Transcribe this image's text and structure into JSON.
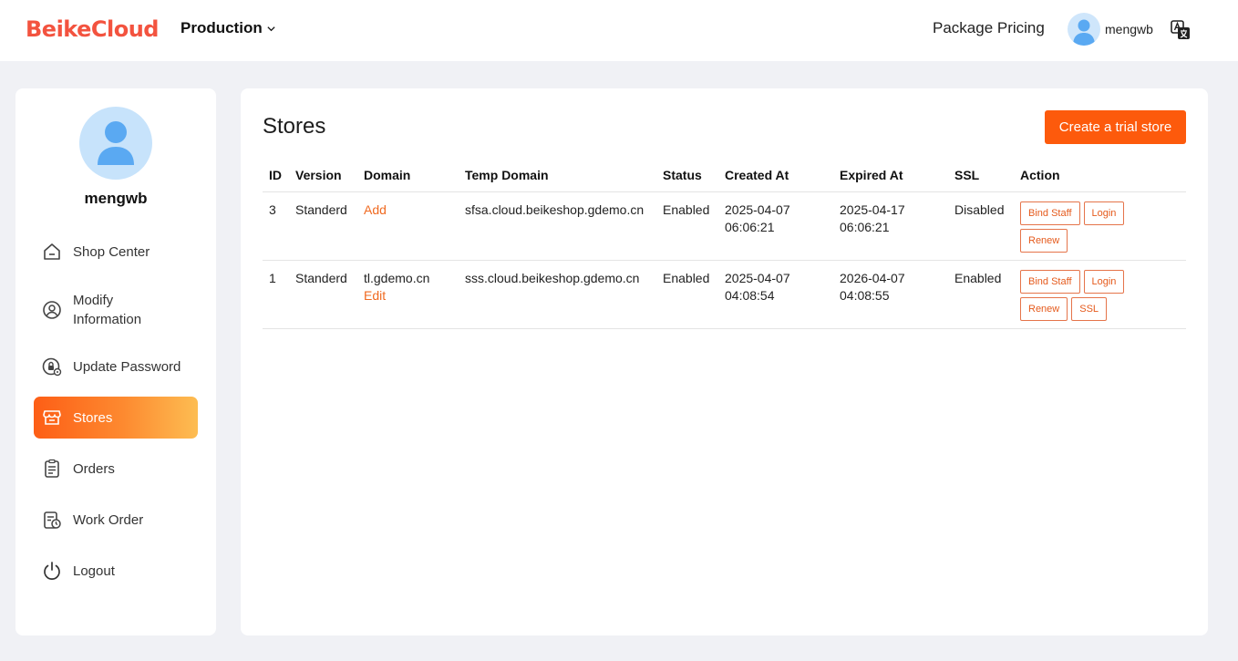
{
  "header": {
    "logo": "BeikeCloud",
    "environment": "Production",
    "package_pricing": "Package Pricing",
    "username": "mengwb"
  },
  "sidebar": {
    "username": "mengwb",
    "items": [
      {
        "label": "Shop Center",
        "icon": "home-icon"
      },
      {
        "label": "Modify Information",
        "icon": "user-circle-icon"
      },
      {
        "label": "Update Password",
        "icon": "password-lock-icon"
      },
      {
        "label": "Stores",
        "icon": "store-icon",
        "active": true
      },
      {
        "label": "Orders",
        "icon": "orders-icon"
      },
      {
        "label": "Work Order",
        "icon": "work-order-icon"
      },
      {
        "label": "Logout",
        "icon": "power-icon"
      }
    ]
  },
  "main": {
    "title": "Stores",
    "create_button": "Create a trial store",
    "columns": [
      "ID",
      "Version",
      "Domain",
      "Temp Domain",
      "Status",
      "Created At",
      "Expired At",
      "SSL",
      "Action"
    ],
    "rows": [
      {
        "id": "3",
        "version": "Standerd",
        "domain": "",
        "domain_link": "Add",
        "temp_domain": "sfsa.cloud.beikeshop.gdemo.cn",
        "status": "Enabled",
        "created_date": "2025-04-07",
        "created_time": "06:06:21",
        "expired_date": "2025-04-17",
        "expired_time": "06:06:21",
        "ssl": "Disabled",
        "actions": [
          "Bind Staff",
          "Login",
          "Renew"
        ]
      },
      {
        "id": "1",
        "version": "Standerd",
        "domain": "tl.gdemo.cn",
        "domain_link": "Edit",
        "temp_domain": "sss.cloud.beikeshop.gdemo.cn",
        "status": "Enabled",
        "created_date": "2025-04-07",
        "created_time": "04:08:54",
        "expired_date": "2026-04-07",
        "expired_time": "04:08:55",
        "ssl": "Enabled",
        "actions": [
          "Bind Staff",
          "Login",
          "Renew",
          "SSL"
        ]
      }
    ]
  },
  "colors": {
    "brand": "#f3533f",
    "accent": "#fd5a0c",
    "link": "#f06a21",
    "background": "#f0f1f5"
  }
}
